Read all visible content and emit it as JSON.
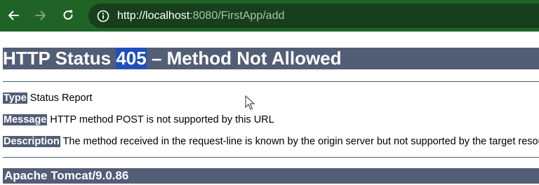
{
  "browser": {
    "url_host": "http://localhost",
    "url_rest": ":8080/FirstApp/add"
  },
  "page": {
    "heading_prefix": "HTTP Status ",
    "heading_code": "405",
    "heading_suffix": " – Method Not Allowed",
    "type_label": "Type",
    "type_value": " Status Report",
    "message_label": "Message",
    "message_value": " HTTP method POST is not supported by this URL",
    "description_label": "Description",
    "description_value": " The method received in the request-line is known by the origin server but not supported by the target resource.",
    "footer": "Apache Tomcat/9.0.86"
  },
  "icons": {
    "back": "arrow-left-icon",
    "forward": "arrow-right-icon",
    "reload": "reload-icon",
    "site_info": "info-icon",
    "cursor": "mouse-pointer-icon"
  }
}
